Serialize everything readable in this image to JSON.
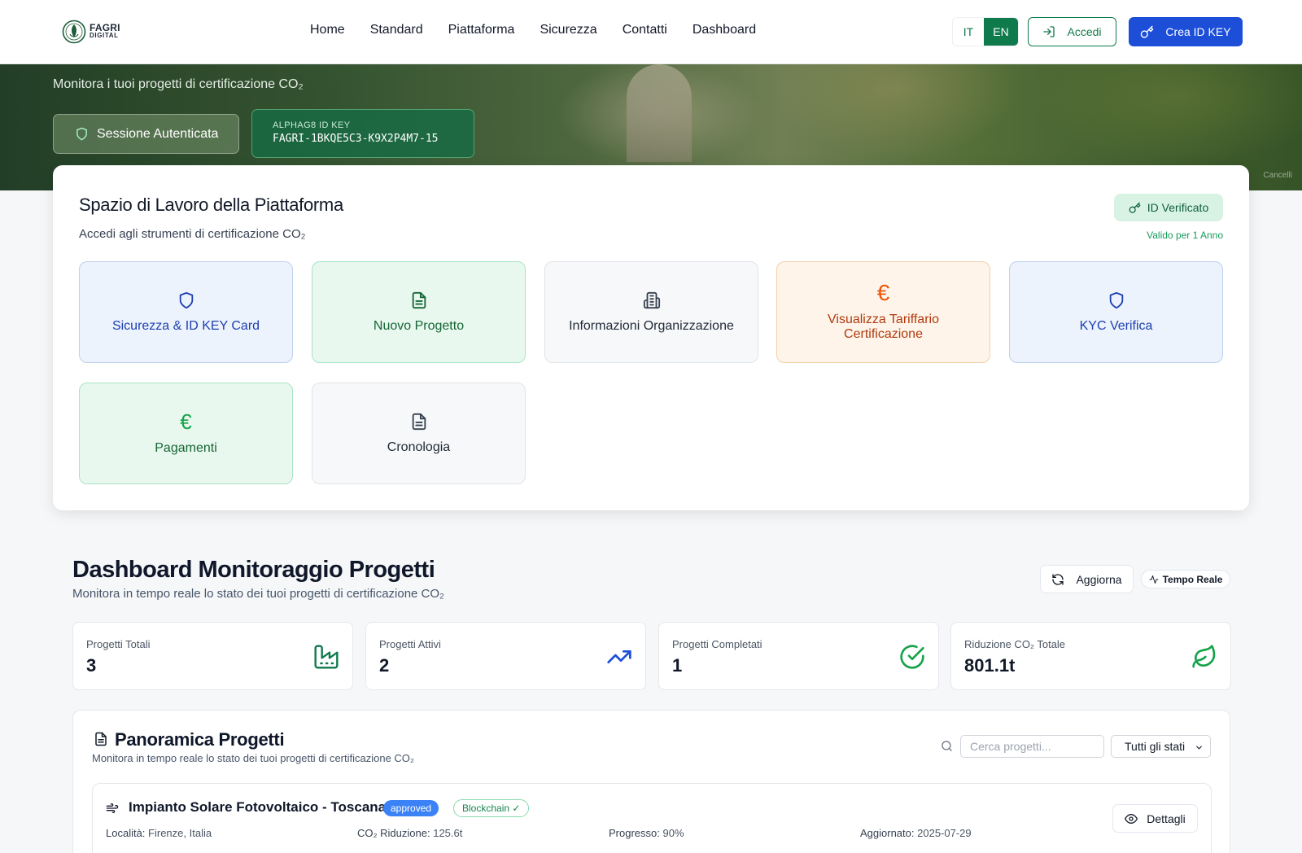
{
  "brand": {
    "name": "FAGRI",
    "sub": "DIGITAL"
  },
  "nav": [
    "Home",
    "Standard",
    "Piattaforma",
    "Sicurezza",
    "Contatti",
    "Dashboard"
  ],
  "lang": {
    "it": "IT",
    "en": "EN",
    "active": "EN"
  },
  "header": {
    "login_label": "Accedi",
    "create_label": "Crea ID KEY"
  },
  "hero": {
    "subtitle": "Monitora i tuoi progetti di certificazione CO₂",
    "session_label": "Sessione Autenticata",
    "idkey_label": "ALPHAG8 ID KEY",
    "idkey_value": "FAGRI-1BKQE5C3-K9X2P4M7-15",
    "credit": "Cancelli"
  },
  "workspace": {
    "title": "Spazio di Lavoro della Piattaforma",
    "subtitle": "Accedi agli strumenti di certificazione CO₂",
    "verified_label": "ID Verificato",
    "valid_label": "Valido per 1 Anno",
    "tiles": [
      {
        "label": "Sicurezza & ID KEY Card",
        "icon": "shield-icon"
      },
      {
        "label": "Nuovo Progetto",
        "icon": "document-icon"
      },
      {
        "label": "Informazioni Organizzazione",
        "icon": "building-icon"
      },
      {
        "label": "Visualizza Tariffario Certificazione",
        "icon": "euro-icon"
      },
      {
        "label": "KYC Verifica",
        "icon": "shield-icon"
      },
      {
        "label": "Pagamenti",
        "icon": "euro-icon"
      },
      {
        "label": "Cronologia",
        "icon": "document-icon"
      }
    ]
  },
  "dashboard": {
    "title": "Dashboard Monitoraggio Progetti",
    "subtitle": "Monitora in tempo reale lo stato dei tuoi progetti di certificazione CO₂",
    "refresh_label": "Aggiorna",
    "live_label": "Tempo Reale",
    "stats": [
      {
        "label": "Progetti Totali",
        "value": "3",
        "icon": "factory-icon"
      },
      {
        "label": "Progetti Attivi",
        "value": "2",
        "icon": "trending-up-icon"
      },
      {
        "label": "Progetti Completati",
        "value": "1",
        "icon": "check-circle-icon"
      },
      {
        "label": "Riduzione CO₂ Totale",
        "value": "801.1t",
        "icon": "leaf-icon"
      }
    ]
  },
  "overview": {
    "title": "Panoramica Progetti",
    "subtitle": "Monitora in tempo reale lo stato dei tuoi progetti di certificazione CO₂",
    "search_placeholder": "Cerca progetti...",
    "filter_value": "Tutti gli stati",
    "projects": [
      {
        "title": "Impianto Solare Fotovoltaico - Toscana",
        "status": "approved",
        "blockchain": "Blockchain ✓",
        "location_label": "Località:",
        "location": "Firenze, Italia",
        "co2_label": "CO₂ Riduzione:",
        "co2": "125.6t",
        "progress_label": "Progresso:",
        "progress": "90%",
        "updated_label": "Aggiornato:",
        "updated": "2025-07-29",
        "details_label": "Dettagli"
      }
    ]
  },
  "colors": {
    "brand_green": "#0f7a4c",
    "primary_blue": "#1d4ed8",
    "accent_blue": "#3b82f6"
  }
}
